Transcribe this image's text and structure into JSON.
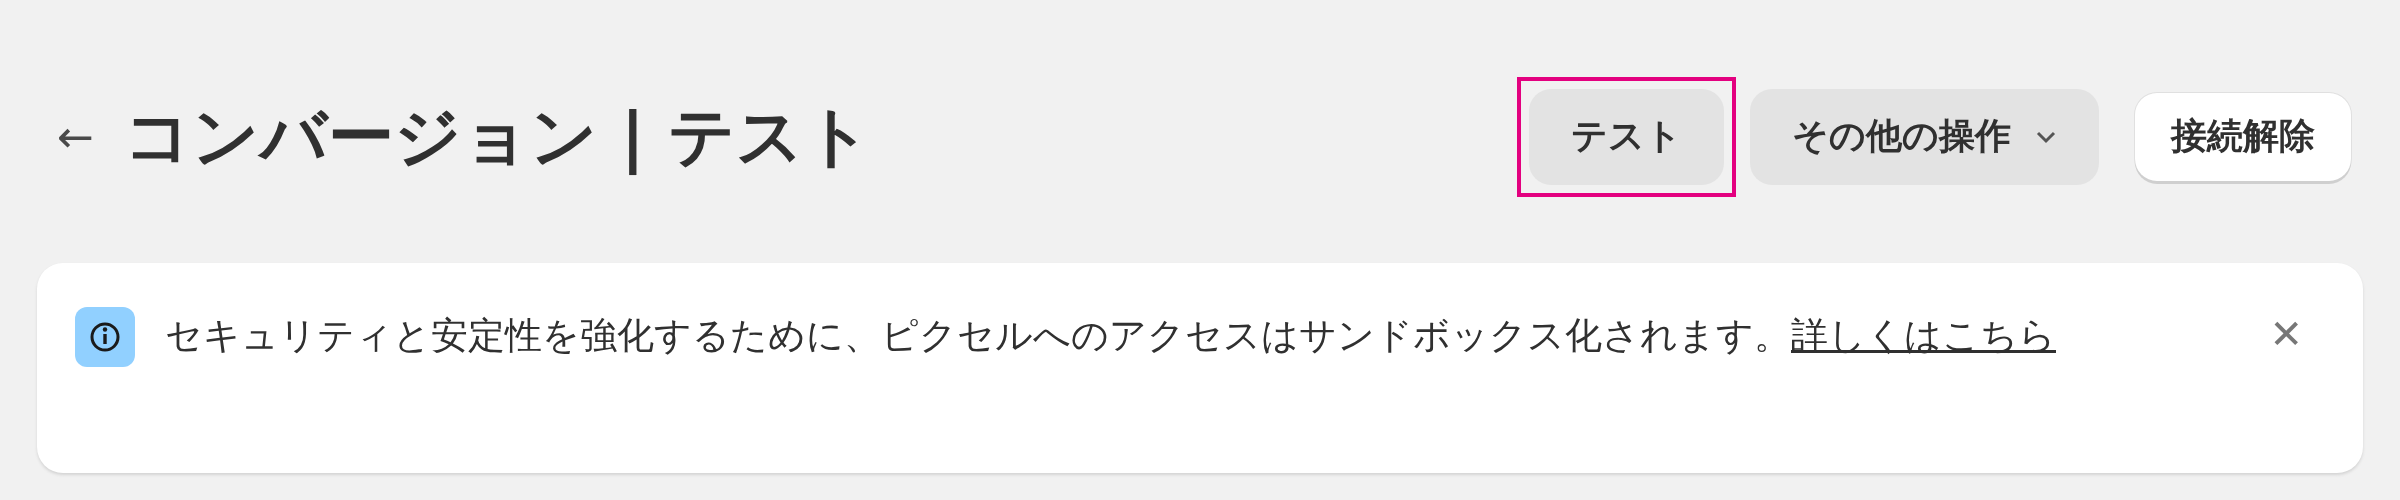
{
  "header": {
    "back": "←",
    "title": "コンバージョン | テスト"
  },
  "buttons": [
    {
      "label": "テスト",
      "kind": "secondary",
      "highlighted": true
    },
    {
      "label": "その他の操作",
      "kind": "menu",
      "highlighted": false
    },
    {
      "label": "接続解除",
      "kind": "primary",
      "highlighted": false
    }
  ],
  "banner": {
    "text": "セキュリティと安定性を強化するために、ピクセルへのアクセスはサンドボックス化されます。",
    "link": "詳しくはこちら",
    "close": "✕"
  }
}
